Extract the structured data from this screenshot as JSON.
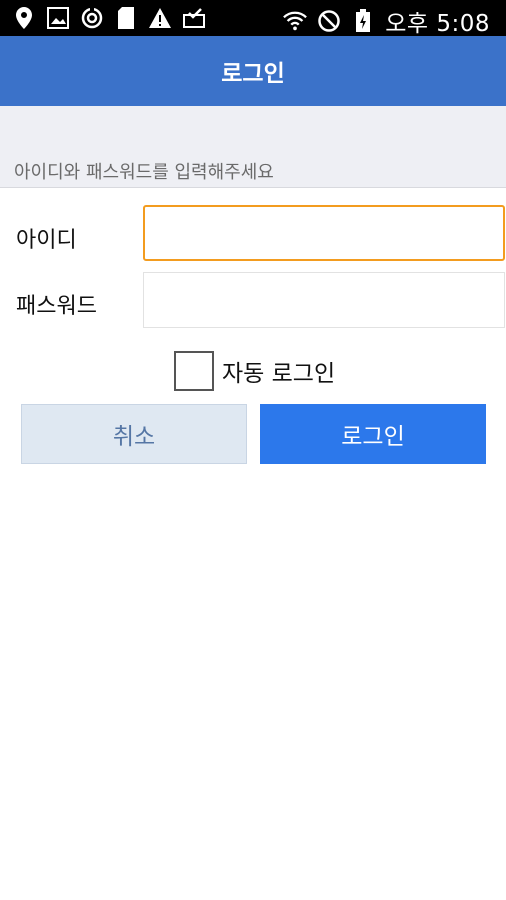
{
  "status_bar": {
    "time": "오후 5:08",
    "left_icons": [
      "location-pin-icon",
      "image-icon",
      "sync-icon",
      "sd-card-icon",
      "warning-icon",
      "mail-check-icon"
    ],
    "right_icons": [
      "wifi-icon",
      "no-sim-icon",
      "battery-charging-icon"
    ]
  },
  "app_bar": {
    "title": "로그인"
  },
  "hint": {
    "text": "아이디와 패스워드를 입력해주세요"
  },
  "form": {
    "id_label": "아이디",
    "id_value": "",
    "password_label": "패스워드",
    "password_value": "",
    "auto_login_label": "자동 로그인",
    "auto_login_checked": false
  },
  "buttons": {
    "cancel": "취소",
    "login": "로그인"
  },
  "colors": {
    "app_bar": "#3b72c9",
    "focus_border": "#f39c1f",
    "login_button": "#2c78eb",
    "cancel_button": "#dfe8f2"
  }
}
